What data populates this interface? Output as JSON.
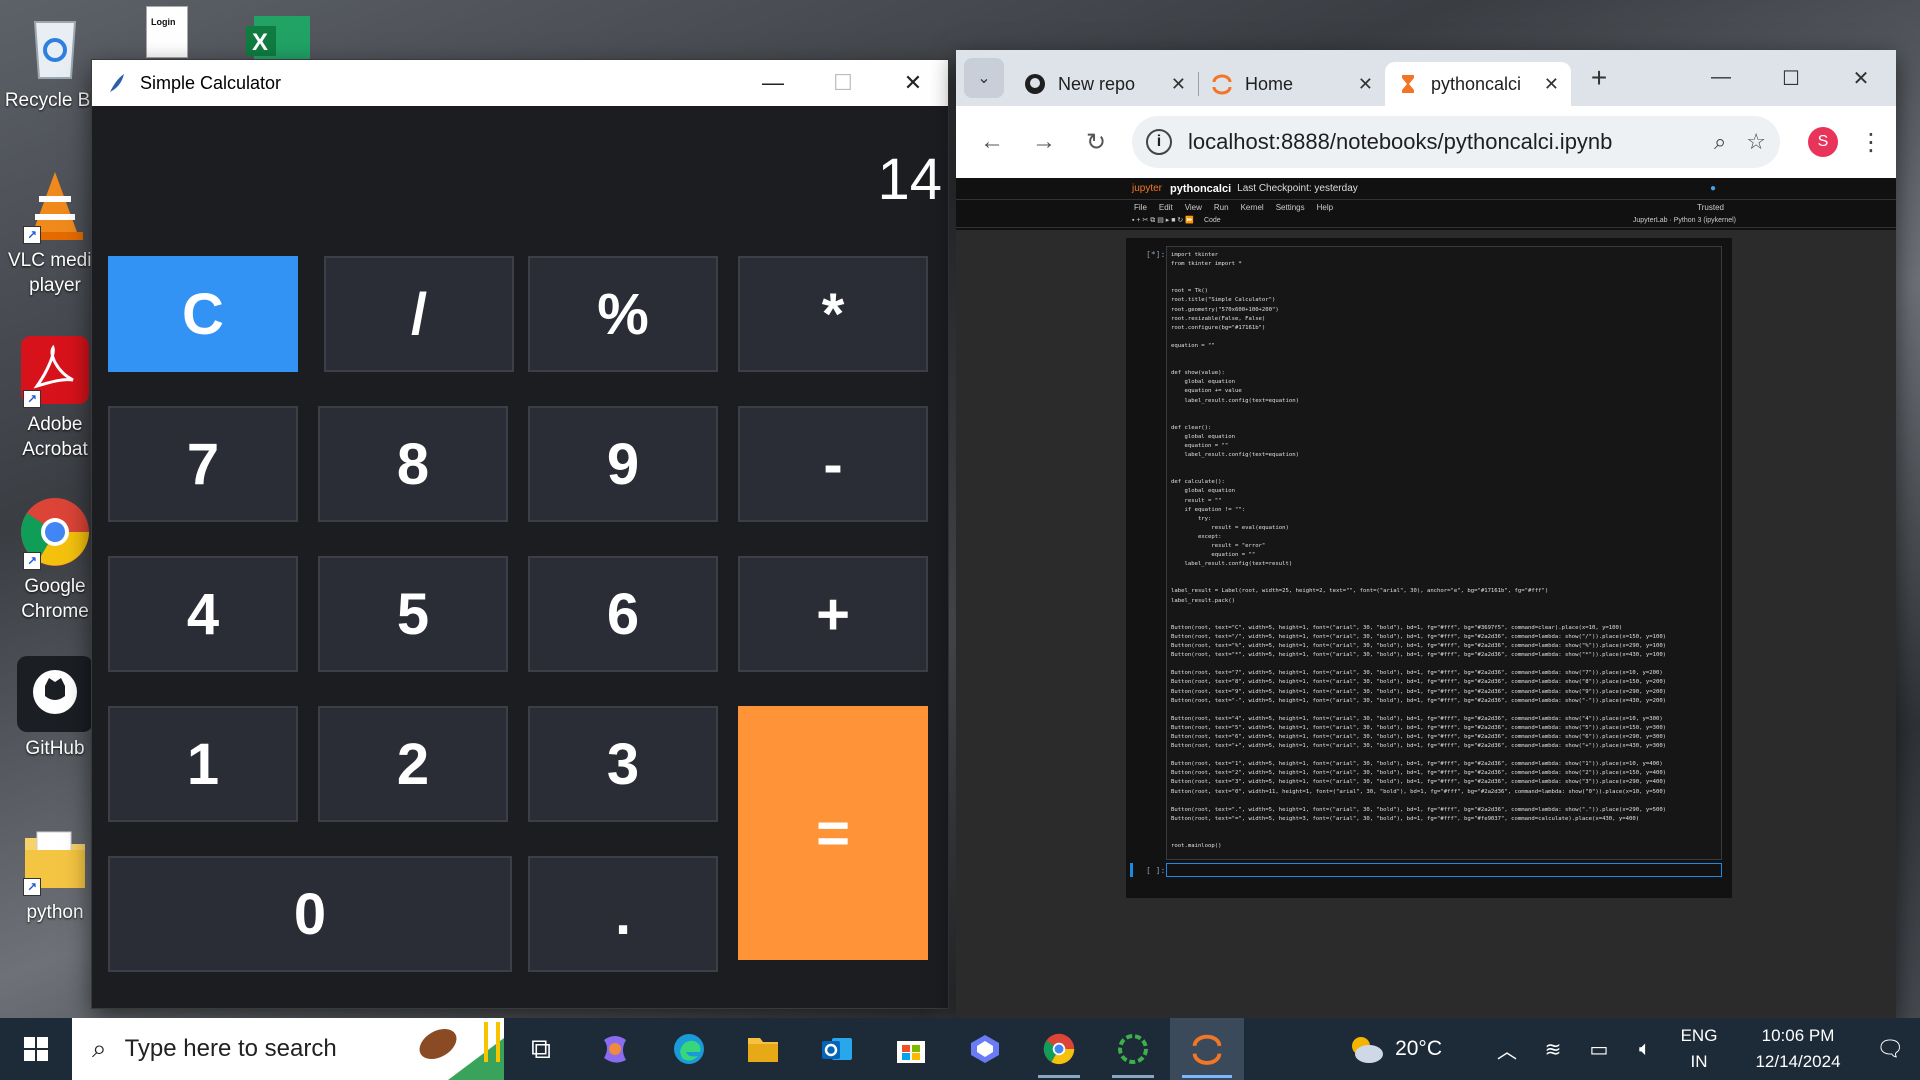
{
  "desktop": {
    "icons": [
      {
        "label": "Recycle Bin"
      },
      {
        "label": "VLC media player"
      },
      {
        "label": "Adobe Acrobat"
      },
      {
        "label": "Google Chrome"
      },
      {
        "label": "GitHub"
      },
      {
        "label": "python"
      }
    ],
    "login_thumb": "Login"
  },
  "calculator": {
    "title": "Simple Calculator",
    "display": "14",
    "buttons": {
      "clear": "C",
      "divide": "/",
      "percent": "%",
      "multiply": "*",
      "seven": "7",
      "eight": "8",
      "nine": "9",
      "minus": "-",
      "four": "4",
      "five": "5",
      "six": "6",
      "plus": "+",
      "one": "1",
      "two": "2",
      "three": "3",
      "equals": "=",
      "zero": "0",
      "dot": "."
    },
    "colors": {
      "background": "#1c1d21",
      "button": "#2a2d35",
      "clear": "#3293f5",
      "equals": "#fe9437"
    }
  },
  "browser": {
    "tabs": [
      {
        "label": "New repo",
        "icon": "github-icon"
      },
      {
        "label": "Home",
        "icon": "jupyter-icon"
      },
      {
        "label": "pythoncalci",
        "icon": "hourglass-icon",
        "active": true
      }
    ],
    "url": "localhost:8888/notebooks/pythoncalci.ipynb",
    "profile_initial": "S"
  },
  "jupyter": {
    "logo": "jupyter",
    "notebook_name": "pythoncalci",
    "checkpoint": "Last Checkpoint: yesterday",
    "trusted": "Trusted",
    "menu": [
      "File",
      "Edit",
      "View",
      "Run",
      "Kernel",
      "Settings",
      "Help"
    ],
    "cell_type": "Code",
    "kernel_info": "JupyterLab  ·  Python 3 (ipykernel)",
    "cell_prompt": "[*]:",
    "empty_prompt": "[ ]:",
    "code": "import tkinter\nfrom tkinter import *\n\n\nroot = Tk()\nroot.title(\"Simple Calculator\")\nroot.geometry(\"570x600+100+200\")\nroot.resizable(False, False)\nroot.configure(bg=\"#17161b\")\n\nequation = \"\"\n\n\ndef show(value):\n    global equation\n    equation += value\n    label_result.config(text=equation)\n\n\ndef clear():\n    global equation\n    equation = \"\"\n    label_result.config(text=equation)\n\n\ndef calculate():\n    global equation\n    result = \"\"\n    if equation != \"\":\n        try:\n            result = eval(equation)\n        except:\n            result = \"error\"\n            equation = \"\"\n    label_result.config(text=result)\n\n\nlabel_result = Label(root, width=25, height=2, text=\"\", font=(\"arial\", 30), anchor=\"e\", bg=\"#17161b\", fg=\"#fff\")\nlabel_result.pack()\n\n\nButton(root, text=\"C\", width=5, height=1, font=(\"arial\", 30, \"bold\"), bd=1, fg=\"#fff\", bg=\"#3697f5\", command=clear).place(x=10, y=100)\nButton(root, text=\"/\", width=5, height=1, font=(\"arial\", 30, \"bold\"), bd=1, fg=\"#fff\", bg=\"#2a2d36\", command=lambda: show(\"/\")).place(x=150, y=100)\nButton(root, text=\"%\", width=5, height=1, font=(\"arial\", 30, \"bold\"), bd=1, fg=\"#fff\", bg=\"#2a2d36\", command=lambda: show(\"%\")).place(x=290, y=100)\nButton(root, text=\"*\", width=5, height=1, font=(\"arial\", 30, \"bold\"), bd=1, fg=\"#fff\", bg=\"#2a2d36\", command=lambda: show(\"*\")).place(x=430, y=100)\n\nButton(root, text=\"7\", width=5, height=1, font=(\"arial\", 30, \"bold\"), bd=1, fg=\"#fff\", bg=\"#2a2d36\", command=lambda: show(\"7\")).place(x=10, y=200)\nButton(root, text=\"8\", width=5, height=1, font=(\"arial\", 30, \"bold\"), bd=1, fg=\"#fff\", bg=\"#2a2d36\", command=lambda: show(\"8\")).place(x=150, y=200)\nButton(root, text=\"9\", width=5, height=1, font=(\"arial\", 30, \"bold\"), bd=1, fg=\"#fff\", bg=\"#2a2d36\", command=lambda: show(\"9\")).place(x=290, y=200)\nButton(root, text=\"-\", width=5, height=1, font=(\"arial\", 30, \"bold\"), bd=1, fg=\"#fff\", bg=\"#2a2d36\", command=lambda: show(\"-\")).place(x=430, y=200)\n\nButton(root, text=\"4\", width=5, height=1, font=(\"arial\", 30, \"bold\"), bd=1, fg=\"#fff\", bg=\"#2a2d36\", command=lambda: show(\"4\")).place(x=10, y=300)\nButton(root, text=\"5\", width=5, height=1, font=(\"arial\", 30, \"bold\"), bd=1, fg=\"#fff\", bg=\"#2a2d36\", command=lambda: show(\"5\")).place(x=150, y=300)\nButton(root, text=\"6\", width=5, height=1, font=(\"arial\", 30, \"bold\"), bd=1, fg=\"#fff\", bg=\"#2a2d36\", command=lambda: show(\"6\")).place(x=290, y=300)\nButton(root, text=\"+\", width=5, height=1, font=(\"arial\", 30, \"bold\"), bd=1, fg=\"#fff\", bg=\"#2a2d36\", command=lambda: show(\"+\")).place(x=430, y=300)\n\nButton(root, text=\"1\", width=5, height=1, font=(\"arial\", 30, \"bold\"), bd=1, fg=\"#fff\", bg=\"#2a2d36\", command=lambda: show(\"1\")).place(x=10, y=400)\nButton(root, text=\"2\", width=5, height=1, font=(\"arial\", 30, \"bold\"), bd=1, fg=\"#fff\", bg=\"#2a2d36\", command=lambda: show(\"2\")).place(x=150, y=400)\nButton(root, text=\"3\", width=5, height=1, font=(\"arial\", 30, \"bold\"), bd=1, fg=\"#fff\", bg=\"#2a2d36\", command=lambda: show(\"3\")).place(x=290, y=400)\nButton(root, text=\"0\", width=11, height=1, font=(\"arial\", 30, \"bold\"), bd=1, fg=\"#fff\", bg=\"#2a2d36\", command=lambda: show(\"0\")).place(x=10, y=500)\n\nButton(root, text=\".\", width=5, height=1, font=(\"arial\", 30, \"bold\"), bd=1, fg=\"#fff\", bg=\"#2a2d36\", command=lambda: show(\".\")).place(x=290, y=500)\nButton(root, text=\"=\", width=5, height=3, font=(\"arial\", 30, \"bold\"), bd=1, fg=\"#fff\", bg=\"#fe9037\", command=calculate).place(x=430, y=400)\n\n\nroot.mainloop()"
  },
  "taskbar": {
    "search_placeholder": "Type here to search",
    "weather": "20°C",
    "language": "ENG",
    "region": "IN",
    "time": "10:06 PM",
    "date": "12/14/2024"
  }
}
